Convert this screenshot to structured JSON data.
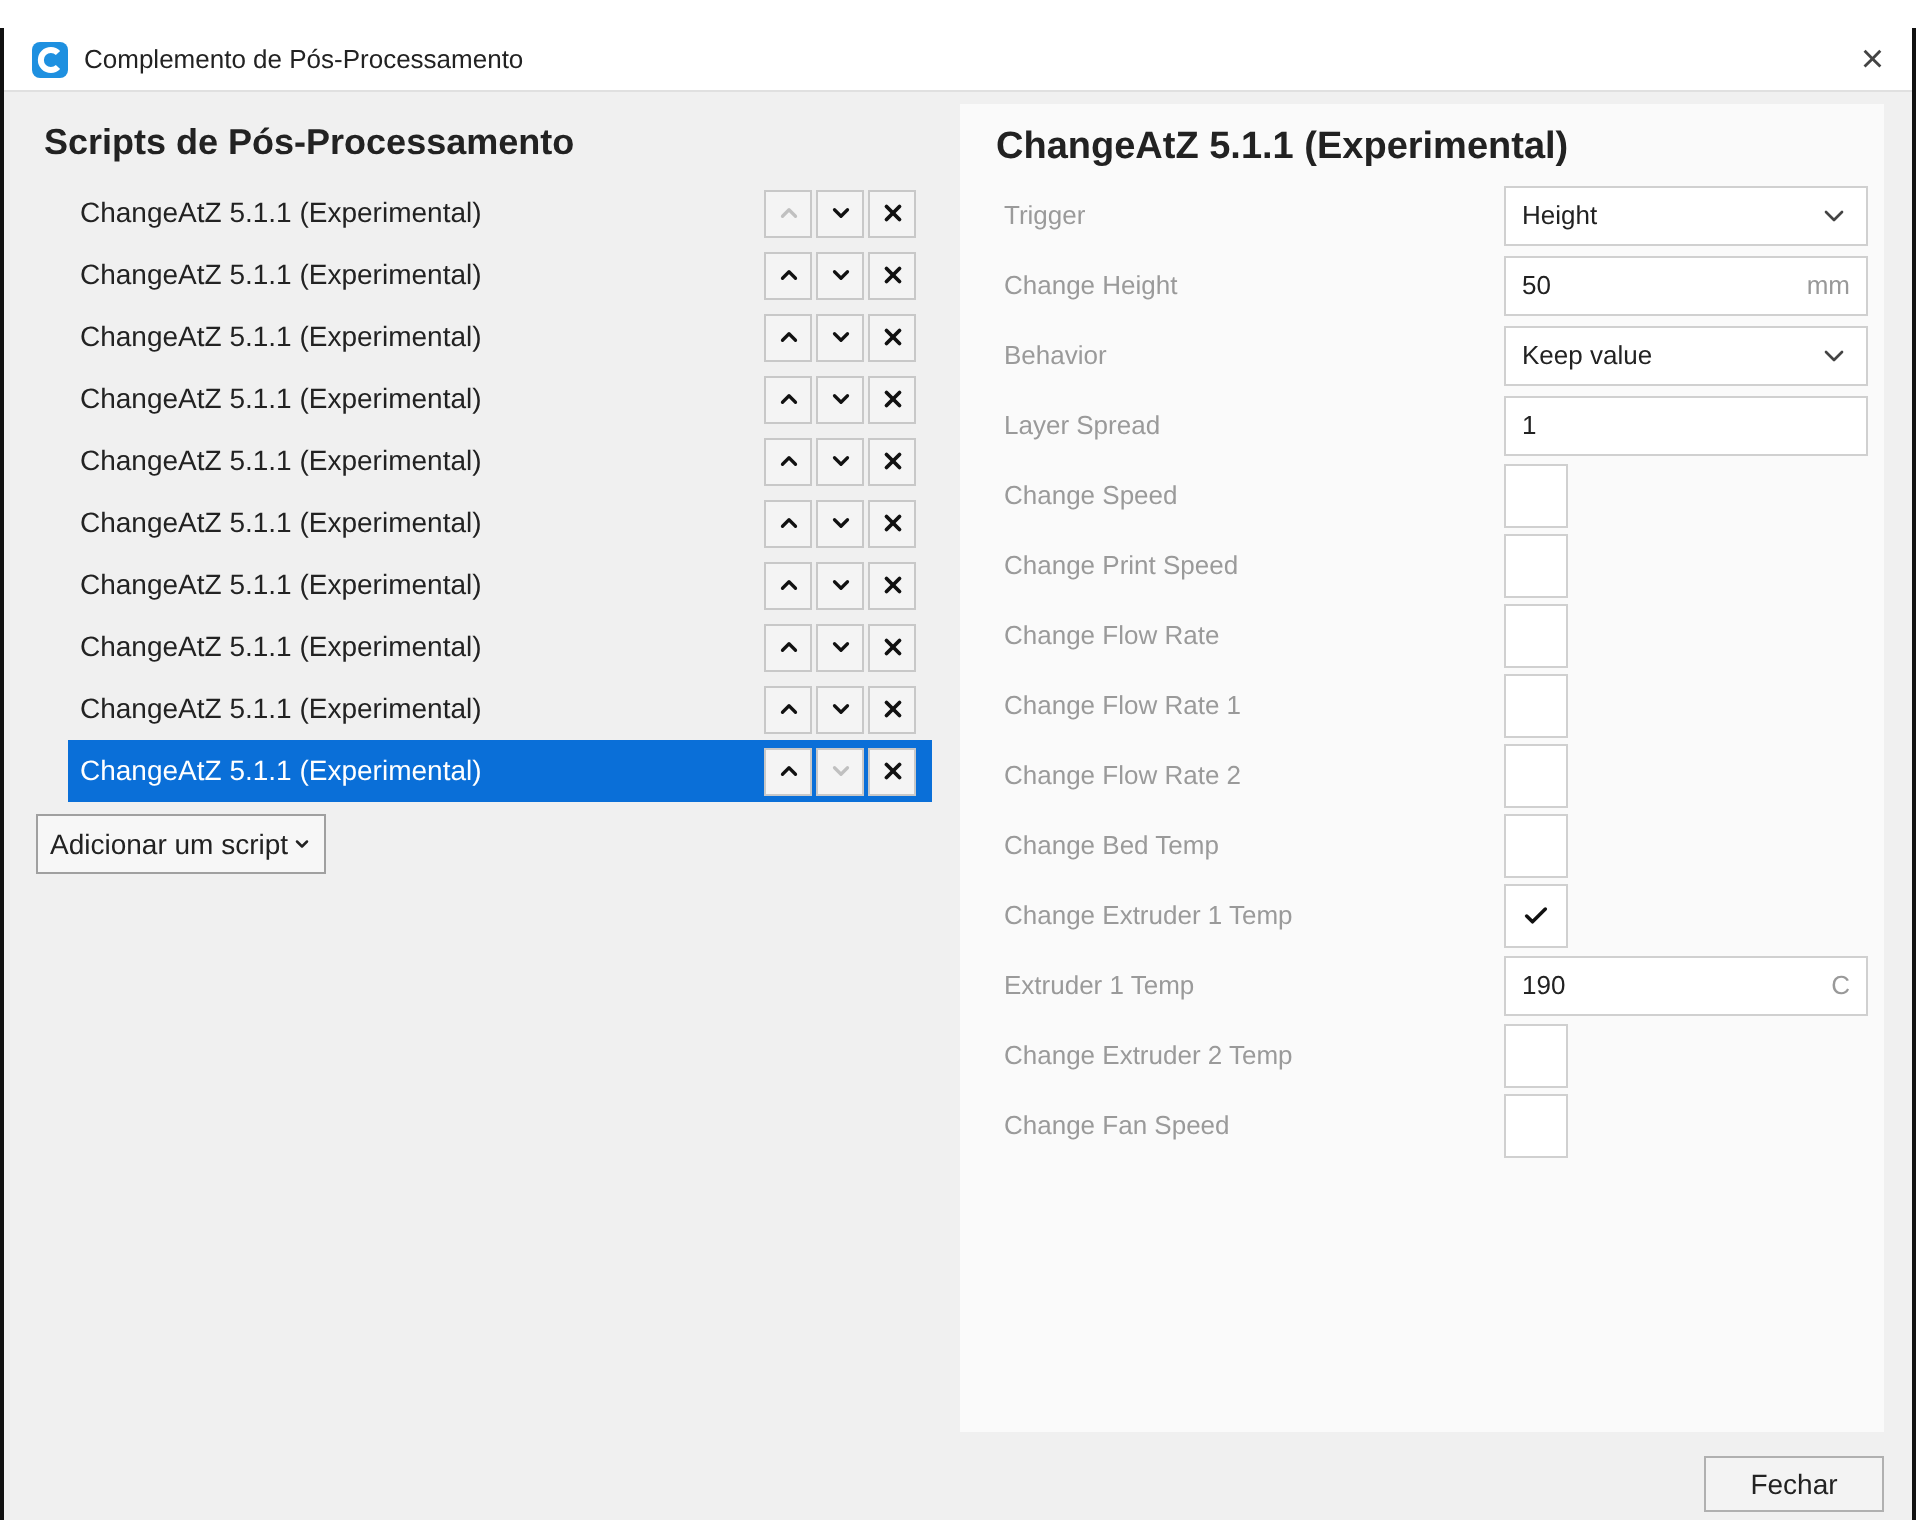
{
  "window": {
    "title": "Complemento de Pós-Processamento",
    "close": "×"
  },
  "scripts_panel": {
    "title": "Scripts de Pós-Processamento",
    "items": [
      {
        "label": "ChangeAtZ 5.1.1 (Experimental)",
        "selected": false,
        "up_disabled": true,
        "down_disabled": false
      },
      {
        "label": "ChangeAtZ 5.1.1 (Experimental)",
        "selected": false,
        "up_disabled": false,
        "down_disabled": false
      },
      {
        "label": "ChangeAtZ 5.1.1 (Experimental)",
        "selected": false,
        "up_disabled": false,
        "down_disabled": false
      },
      {
        "label": "ChangeAtZ 5.1.1 (Experimental)",
        "selected": false,
        "up_disabled": false,
        "down_disabled": false
      },
      {
        "label": "ChangeAtZ 5.1.1 (Experimental)",
        "selected": false,
        "up_disabled": false,
        "down_disabled": false
      },
      {
        "label": "ChangeAtZ 5.1.1 (Experimental)",
        "selected": false,
        "up_disabled": false,
        "down_disabled": false
      },
      {
        "label": "ChangeAtZ 5.1.1 (Experimental)",
        "selected": false,
        "up_disabled": false,
        "down_disabled": false
      },
      {
        "label": "ChangeAtZ 5.1.1 (Experimental)",
        "selected": false,
        "up_disabled": false,
        "down_disabled": false
      },
      {
        "label": "ChangeAtZ 5.1.1 (Experimental)",
        "selected": false,
        "up_disabled": false,
        "down_disabled": false
      },
      {
        "label": "ChangeAtZ 5.1.1 (Experimental)",
        "selected": true,
        "up_disabled": false,
        "down_disabled": true
      }
    ],
    "add_button": "Adicionar um script"
  },
  "settings_panel": {
    "title": "ChangeAtZ 5.1.1 (Experimental)",
    "settings": [
      {
        "kind": "dropdown",
        "label": "Trigger",
        "value": "Height"
      },
      {
        "kind": "number",
        "label": "Change Height",
        "value": "50",
        "unit": "mm"
      },
      {
        "kind": "dropdown",
        "label": "Behavior",
        "value": "Keep value"
      },
      {
        "kind": "number",
        "label": "Layer Spread",
        "value": "1"
      },
      {
        "kind": "checkbox",
        "label": "Change Speed",
        "checked": false
      },
      {
        "kind": "checkbox",
        "label": "Change Print Speed",
        "checked": false
      },
      {
        "kind": "checkbox",
        "label": "Change Flow Rate",
        "checked": false
      },
      {
        "kind": "checkbox",
        "label": "Change Flow Rate 1",
        "checked": false
      },
      {
        "kind": "checkbox",
        "label": "Change Flow Rate 2",
        "checked": false
      },
      {
        "kind": "checkbox",
        "label": "Change Bed Temp",
        "checked": false
      },
      {
        "kind": "checkbox",
        "label": "Change Extruder 1 Temp",
        "checked": true
      },
      {
        "kind": "number",
        "label": "Extruder 1 Temp",
        "value": "190",
        "unit": "C"
      },
      {
        "kind": "checkbox",
        "label": "Change Extruder 2 Temp",
        "checked": false
      },
      {
        "kind": "checkbox",
        "label": "Change Fan Speed",
        "checked": false
      }
    ]
  },
  "close_button": "Fechar"
}
